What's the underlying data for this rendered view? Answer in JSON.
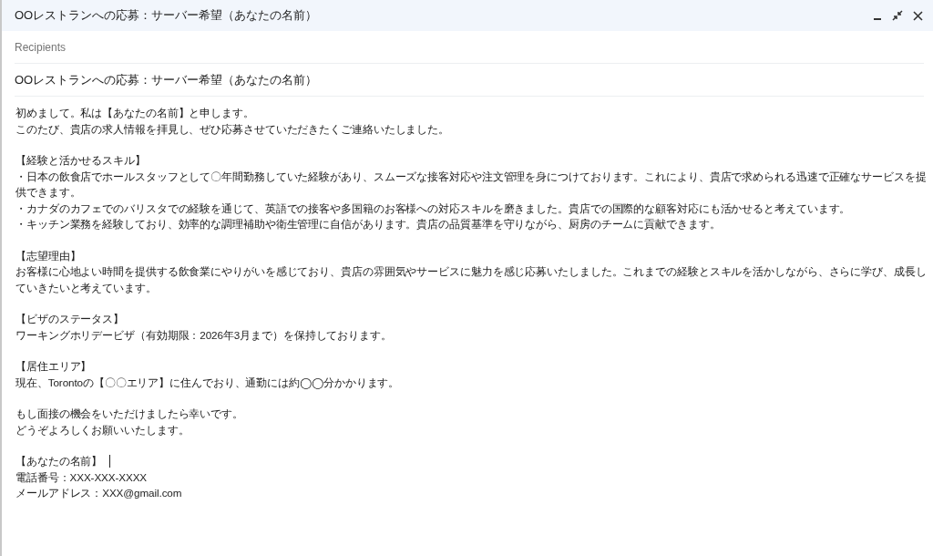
{
  "window": {
    "title": "OOレストランへの応募：サーバー希望（あなたの名前）"
  },
  "recipients": {
    "placeholder": "Recipients"
  },
  "subject": {
    "value": "OOレストランへの応募：サーバー希望（あなたの名前）"
  },
  "body": {
    "sections": [
      {
        "lines": [
          {
            "text": "初めまして。私は【あなたの名前】と申します。"
          },
          {
            "text": "このたび、貴店の求人情報を拝見し、ぜひ応募させていただきたくご連絡いたしました。"
          }
        ]
      },
      {
        "lines": [
          {
            "text": "【経験と活かせるスキル】"
          },
          {
            "text": "・日本の飲食店でホールスタッフとして〇年間勤務していた経験があり、スムーズな接客対応や注文管理を身につけております。これにより、貴店で求められる迅速で正確なサービスを提供できます。"
          },
          {
            "text": "・カナダのカフェでのバリスタでの経験を通じて、英語での接客や多国籍のお客様への対応スキルを磨きました。貴店での国際的な顧客対応にも活かせると考えています。"
          },
          {
            "text": "・キッチン業務を経験しており、効率的な調理補助や衛生管理に自信があります。貴店の品質基準を守りながら、厨房のチームに貢献できます。"
          }
        ]
      },
      {
        "lines": [
          {
            "text": "【志望理由】"
          },
          {
            "text": "お客様に心地よい時間を提供する飲食業にやりがいを感じており、貴店の雰囲気やサービスに魅力を感じ応募いたしました。これまでの経験とスキルを活かしながら、さらに学び、成長していきたいと考えています。"
          }
        ]
      },
      {
        "lines": [
          {
            "text": "【ビザのステータス】"
          },
          {
            "text": "ワーキングホリデービザ（有効期限：2026年3月まで）を保持しております。"
          }
        ]
      },
      {
        "lines": [
          {
            "text": "【居住エリア】"
          },
          {
            "text": "現在、Torontoの【〇〇エリア】に住んでおり、通勤には約◯◯分かかります。"
          }
        ]
      },
      {
        "lines": [
          {
            "text": "もし面接の機会をいただけましたら幸いです。"
          },
          {
            "text": "どうぞよろしくお願いいたします。"
          }
        ]
      },
      {
        "lines": [
          {
            "text": "【あなたの名前】",
            "caret": true
          },
          {
            "text": "電話番号：XXX-XXX-XXXX"
          },
          {
            "text": "メールアドレス：XXX@gmail.com"
          }
        ]
      }
    ]
  }
}
